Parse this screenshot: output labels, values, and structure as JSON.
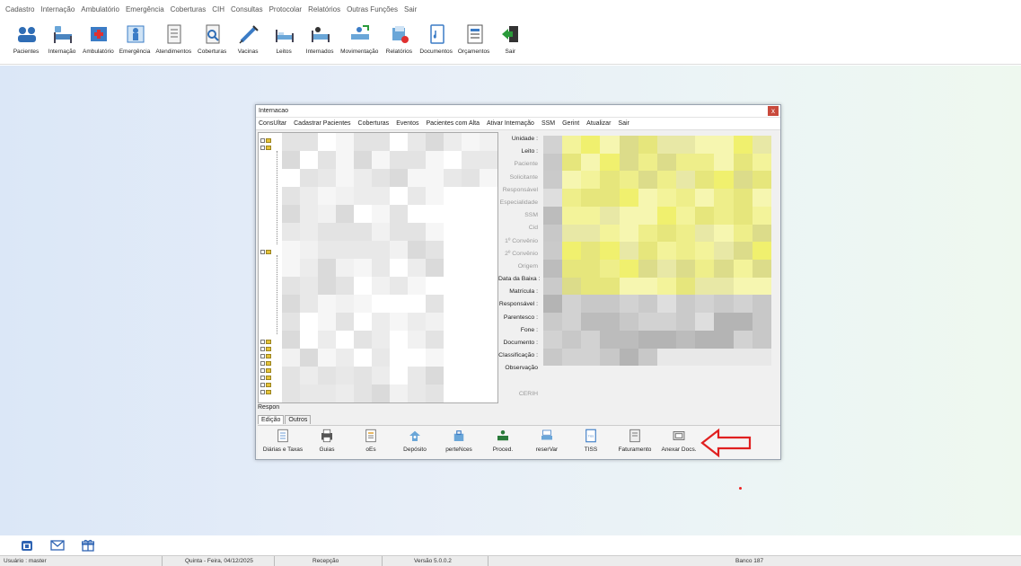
{
  "menubar": [
    "Cadastro",
    "Internação",
    "Ambulatório",
    "Emergência",
    "Coberturas",
    "CIH",
    "Consultas",
    "Protocolar",
    "Relatórios",
    "Outras Funções",
    "Sair"
  ],
  "toolbar": [
    {
      "label": "Pacientes",
      "icon": "users-icon"
    },
    {
      "label": "Internação",
      "icon": "bed-icon"
    },
    {
      "label": "Ambulatório",
      "icon": "clinic-icon"
    },
    {
      "label": "Emergência",
      "icon": "emergency-icon"
    },
    {
      "label": "Atendimentos",
      "icon": "document-icon"
    },
    {
      "label": "Coberturas",
      "icon": "search-document-icon"
    },
    {
      "label": "Vacinas",
      "icon": "syringe-icon"
    },
    {
      "label": "Leitos",
      "icon": "hospital-bed-icon"
    },
    {
      "label": "Internados",
      "icon": "patient-bed-icon"
    },
    {
      "label": "Movimentação",
      "icon": "movement-icon"
    },
    {
      "label": "Relatórios",
      "icon": "reports-icon"
    },
    {
      "label": "Documentos",
      "icon": "documents-icon"
    },
    {
      "label": "Orçamentos",
      "icon": "budget-icon"
    },
    {
      "label": "Sair",
      "icon": "exit-icon"
    }
  ],
  "window": {
    "title": "Internacao",
    "close": "x",
    "menu": [
      "ConsUltar",
      "Cadastrar Pacientes",
      "Coberturas",
      "Eventos",
      "Pacientes com Alta",
      "Ativar Internação",
      "SSM",
      "Gerint",
      "Atualizar",
      "Sair"
    ],
    "respon": "Respon",
    "tabs": [
      "Edição",
      "Outros"
    ],
    "form_labels": [
      {
        "text": "Unidade :",
        "dim": false
      },
      {
        "text": "Leito :",
        "dim": false
      },
      {
        "text": "Paciente",
        "dim": true
      },
      {
        "text": "Solicitante",
        "dim": true
      },
      {
        "text": "Responsável",
        "dim": true
      },
      {
        "text": "Especialidade",
        "dim": true
      },
      {
        "text": "SSM",
        "dim": true
      },
      {
        "text": "Cid",
        "dim": true
      },
      {
        "text": "1º Convênio",
        "dim": true
      },
      {
        "text": "2º Convênio",
        "dim": true
      },
      {
        "text": "Origem",
        "dim": true
      },
      {
        "text": "Data da Baixa :",
        "dim": false
      },
      {
        "text": "Matrícula :",
        "dim": false
      },
      {
        "text": "Responsável :",
        "dim": false
      },
      {
        "text": "Parentesco :",
        "dim": false
      },
      {
        "text": "Fone :",
        "dim": false
      },
      {
        "text": "Documento :",
        "dim": false
      },
      {
        "text": "Classificação :",
        "dim": false
      },
      {
        "text": "Observação",
        "dim": false
      },
      {
        "text": "",
        "dim": true
      },
      {
        "text": "CERIH",
        "dim": true
      }
    ],
    "bottom_buttons": [
      {
        "label": "Diárias e Taxas",
        "icon": "list-icon"
      },
      {
        "label": "Guias",
        "icon": "printer-icon"
      },
      {
        "label": "oEs",
        "icon": "note-icon"
      },
      {
        "label": "Depósito",
        "icon": "deposit-icon"
      },
      {
        "label": "perteNces",
        "icon": "belongings-icon"
      },
      {
        "label": "Proced.",
        "icon": "procedure-icon"
      },
      {
        "label": "reserVar",
        "icon": "reserve-icon"
      },
      {
        "label": "TISS",
        "icon": "tiss-icon"
      },
      {
        "label": "Faturamento",
        "icon": "billing-icon"
      },
      {
        "label": "Anexar Docs.",
        "icon": "attach-docs-icon"
      }
    ]
  },
  "colors": {
    "accent_red": "#e02020",
    "close_red": "#c94a3c",
    "folder_yellow": "#e4c23a"
  },
  "statusbar": {
    "user": "Usuário : master",
    "date": "Quinta - Feira, 04/12/2025",
    "role": "Recepção",
    "version": "Versão 5.0.0.2",
    "bank": "Banco 187"
  }
}
